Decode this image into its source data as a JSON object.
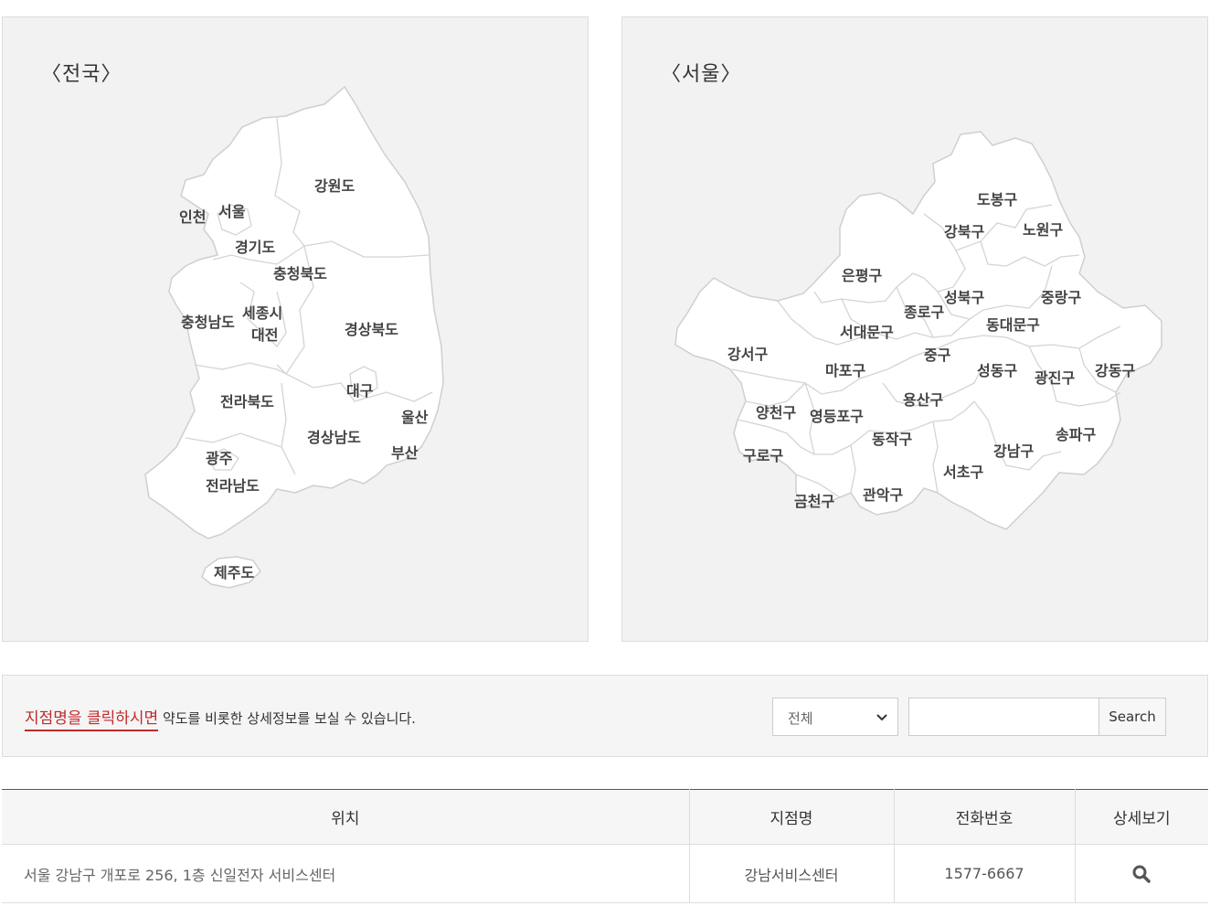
{
  "national_map": {
    "title": "〈전국〉",
    "regions": [
      "강원도",
      "인천",
      "서울",
      "경기도",
      "충청북도",
      "충청남도",
      "세종시",
      "대전",
      "경상북도",
      "대구",
      "전라북도",
      "울산",
      "경상남도",
      "부산",
      "광주",
      "전라남도",
      "제주도"
    ]
  },
  "seoul_map": {
    "title": "〈서울〉",
    "districts": [
      "도봉구",
      "강북구",
      "노원구",
      "은평구",
      "성북구",
      "중랑구",
      "종로구",
      "서대문구",
      "동대문구",
      "강서구",
      "중구",
      "마포구",
      "성동구",
      "광진구",
      "강동구",
      "용산구",
      "양천구",
      "영등포구",
      "송파구",
      "동작구",
      "강남구",
      "구로구",
      "서초구",
      "관악구",
      "금천구"
    ]
  },
  "search": {
    "notice_highlight": "지점명을 클릭하시면",
    "notice_rest": " 약도를 비롯한 상세정보를 보실 수 있습니다.",
    "select_value": "전체",
    "input_value": "",
    "button_label": "Search"
  },
  "table": {
    "headers": [
      "위치",
      "지점명",
      "전화번호",
      "상세보기"
    ],
    "rows": [
      {
        "address": "서울 강남구 개포로 256, 1층 신일전자 서비스센터",
        "branch": "강남서비스센터",
        "phone": "1577-6667",
        "detail_icon": "search-icon"
      }
    ]
  }
}
